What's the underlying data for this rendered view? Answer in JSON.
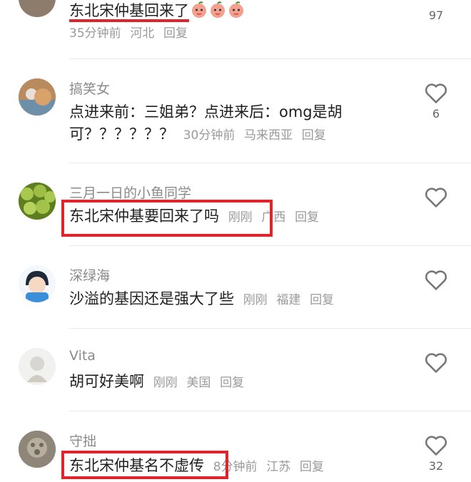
{
  "comments": [
    {
      "text": "东北宋仲基回来了",
      "time": "35分钟前",
      "location": "河北",
      "reply": "回复",
      "likes": "97",
      "emoji": "peach-face-emoji"
    },
    {
      "username": "搞笑女",
      "text_line1": "点进来前：三姐弟？点进来后：omg是胡",
      "text_line2": "可？？？？？？",
      "time": "30分钟前",
      "location": "马来西亚",
      "reply": "回复",
      "likes": "6"
    },
    {
      "username": "三月一日的小鱼同学",
      "text": "东北宋仲基要回来了吗",
      "time": "刚刚",
      "location": "广西",
      "reply": "回复"
    },
    {
      "username": "深绿海",
      "text": "沙溢的基因还是强大了些",
      "time": "刚刚",
      "location": "福建",
      "reply": "回复"
    },
    {
      "username": "Vita",
      "text": "胡可好美啊",
      "time": "刚刚",
      "location": "美国",
      "reply": "回复"
    },
    {
      "username": "守拙",
      "text": "东北宋仲基名不虚传",
      "time": "8分钟前",
      "location": "江苏",
      "reply": "回复",
      "likes": "32"
    }
  ],
  "colors": {
    "highlight": "#e0242b",
    "meta": "#9a9a9a",
    "username": "#8a8a8a"
  }
}
